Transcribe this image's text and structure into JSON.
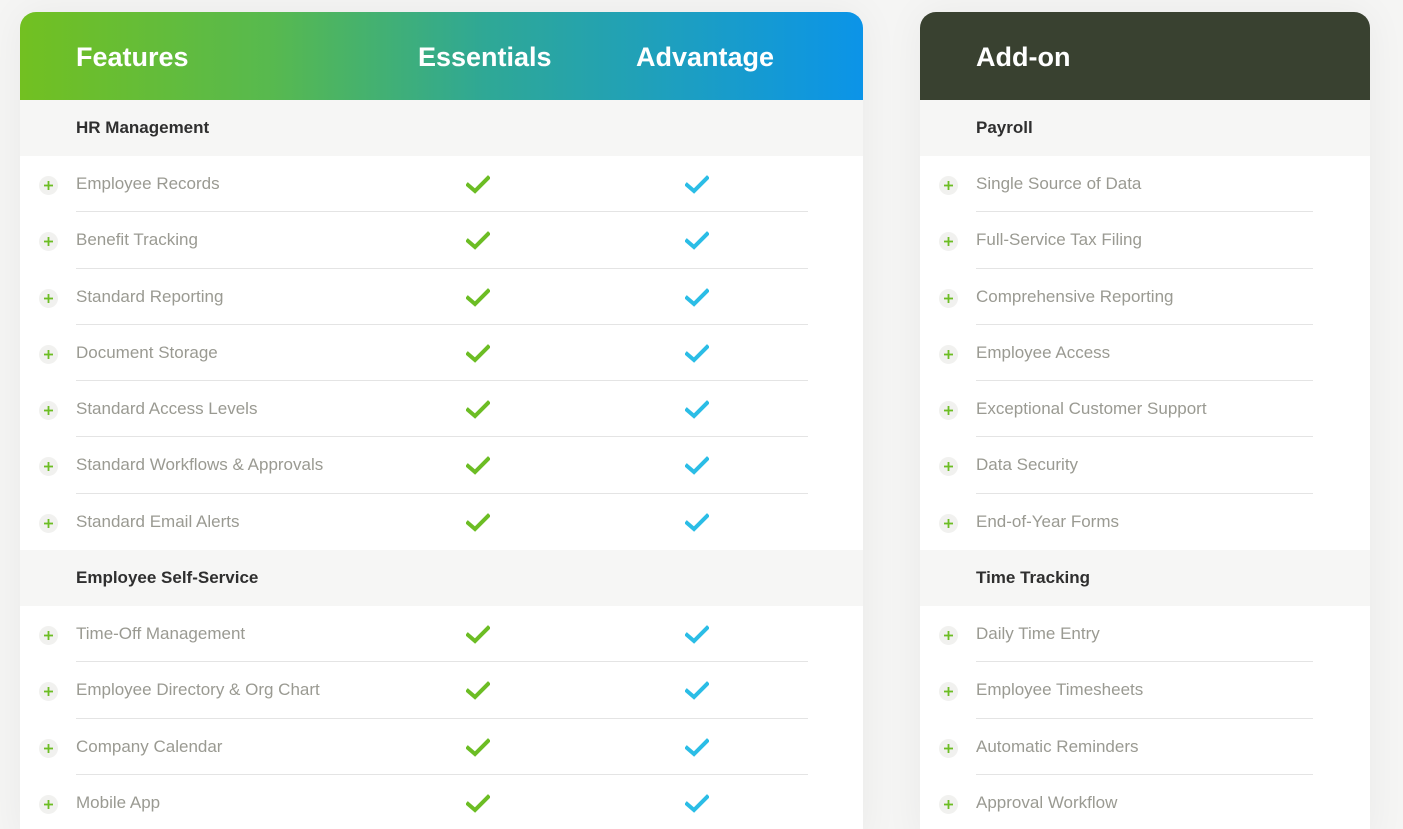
{
  "features_table": {
    "header": {
      "features_label": "Features",
      "essentials_label": "Essentials",
      "advantage_label": "Advantage"
    },
    "colors": {
      "essentials_check": "#6cbd24",
      "advantage_check": "#2bbde6",
      "plus_icon": "#6cbd24"
    },
    "sections": [
      {
        "title": "HR Management",
        "items": [
          {
            "label": "Employee Records",
            "essentials": true,
            "advantage": true
          },
          {
            "label": "Benefit Tracking",
            "essentials": true,
            "advantage": true
          },
          {
            "label": "Standard Reporting",
            "essentials": true,
            "advantage": true
          },
          {
            "label": "Document Storage",
            "essentials": true,
            "advantage": true
          },
          {
            "label": "Standard Access Levels",
            "essentials": true,
            "advantage": true
          },
          {
            "label": "Standard Workflows & Approvals",
            "essentials": true,
            "advantage": true
          },
          {
            "label": "Standard Email Alerts",
            "essentials": true,
            "advantage": true
          }
        ]
      },
      {
        "title": "Employee Self-Service",
        "items": [
          {
            "label": "Time-Off Management",
            "essentials": true,
            "advantage": true
          },
          {
            "label": "Employee Directory & Org Chart",
            "essentials": true,
            "advantage": true
          },
          {
            "label": "Company Calendar",
            "essentials": true,
            "advantage": true
          },
          {
            "label": "Mobile App",
            "essentials": true,
            "advantage": true
          }
        ]
      }
    ]
  },
  "addon_table": {
    "header": {
      "title": "Add-on"
    },
    "colors": {
      "header_bg": "#394130"
    },
    "sections": [
      {
        "title": "Payroll",
        "items": [
          {
            "label": "Single Source of Data"
          },
          {
            "label": "Full-Service Tax Filing"
          },
          {
            "label": "Comprehensive Reporting"
          },
          {
            "label": "Employee Access"
          },
          {
            "label": "Exceptional Customer Support"
          },
          {
            "label": "Data Security"
          },
          {
            "label": "End-of-Year Forms"
          }
        ]
      },
      {
        "title": "Time Tracking",
        "items": [
          {
            "label": "Daily Time Entry"
          },
          {
            "label": "Employee Timesheets"
          },
          {
            "label": "Automatic Reminders"
          },
          {
            "label": "Approval Workflow"
          }
        ]
      }
    ]
  }
}
